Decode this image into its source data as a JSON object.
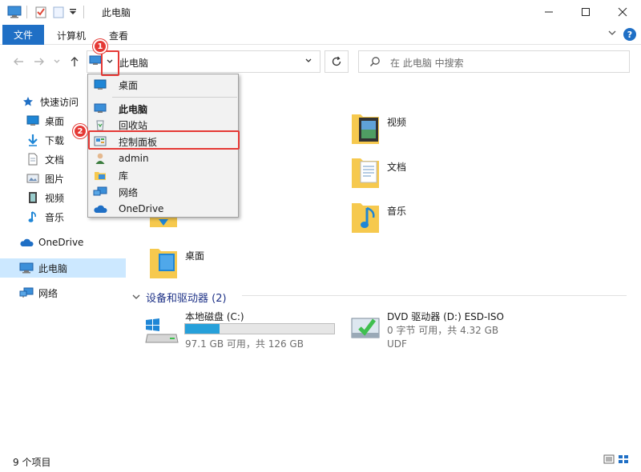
{
  "window": {
    "title": "此电脑"
  },
  "ribbon": {
    "file_tab": "文件",
    "tabs": [
      "计算机",
      "查看"
    ]
  },
  "address": {
    "path": "此电脑"
  },
  "search": {
    "placeholder": "在 此电脑 中搜索"
  },
  "sidebar": {
    "quick_access": "快速访问",
    "quick_items": [
      "桌面",
      "下载",
      "文档",
      "图片",
      "视频",
      "音乐"
    ],
    "onedrive": "OneDrive",
    "this_pc": "此电脑",
    "network": "网络"
  },
  "content": {
    "folders": [
      "视频",
      "文档",
      "音乐",
      "桌面"
    ],
    "devices_header": "设备和驱动器 (2)",
    "drives": [
      {
        "name": "本地磁盘 (C:)",
        "detail": "97.1 GB 可用，共 126 GB",
        "used_fraction": 0.23
      },
      {
        "name": "DVD 驱动器 (D:) ESD-ISO",
        "detail": "0 字节 可用，共 4.32 GB",
        "fs": "UDF"
      }
    ]
  },
  "menu": {
    "items": [
      "桌面",
      "此电脑",
      "回收站",
      "控制面板",
      "admin",
      "库",
      "网络",
      "OneDrive"
    ]
  },
  "annotations": {
    "badge_1": "1",
    "badge_2": "2"
  },
  "status": {
    "item_count": "9 个项目"
  },
  "colors": {
    "accent": "#1f6fc5",
    "highlight": "#e53935",
    "selection": "#cce8ff",
    "folder": "#f6c94e"
  }
}
